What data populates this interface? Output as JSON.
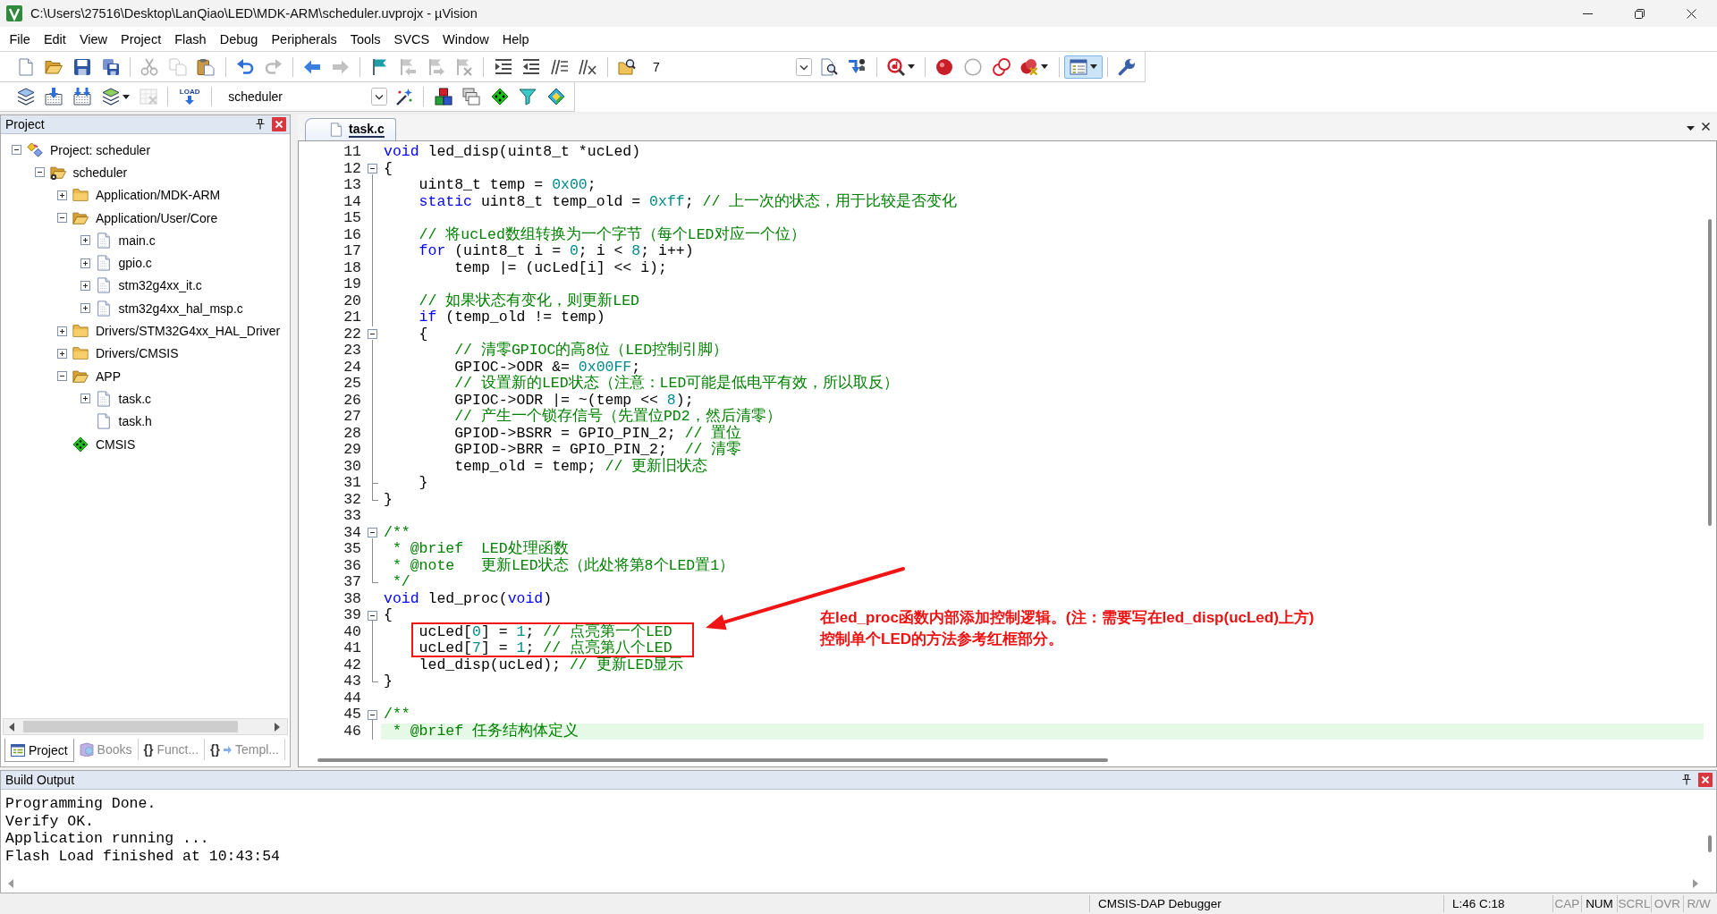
{
  "window": {
    "title": "C:\\Users\\27516\\Desktop\\LanQiao\\LED\\MDK-ARM\\scheduler.uvprojx - µVision"
  },
  "menu": [
    "File",
    "Edit",
    "View",
    "Project",
    "Flash",
    "Debug",
    "Peripherals",
    "Tools",
    "SVCS",
    "Window",
    "Help"
  ],
  "toolbars": [
    {
      "items": [
        {
          "kind": "new",
          "disabled": false,
          "pressed": false
        },
        {
          "kind": "open",
          "disabled": false,
          "pressed": false
        },
        {
          "kind": "save",
          "disabled": false,
          "pressed": false
        },
        {
          "kind": "saveall",
          "disabled": false,
          "pressed": false
        },
        {
          "kind": "separator"
        },
        {
          "kind": "cut",
          "disabled": true,
          "pressed": false
        },
        {
          "kind": "copy",
          "disabled": true,
          "pressed": false
        },
        {
          "kind": "paste",
          "disabled": false,
          "pressed": false
        },
        {
          "kind": "separator"
        },
        {
          "kind": "undo",
          "disabled": false,
          "pressed": false
        },
        {
          "kind": "redo",
          "disabled": true,
          "pressed": false
        },
        {
          "kind": "separator"
        },
        {
          "kind": "back",
          "disabled": false,
          "pressed": false
        },
        {
          "kind": "forward",
          "disabled": true,
          "pressed": false
        },
        {
          "kind": "separator"
        },
        {
          "kind": "bookmark",
          "disabled": false,
          "pressed": false
        },
        {
          "kind": "prevmark",
          "disabled": true,
          "pressed": false
        },
        {
          "kind": "nextmark",
          "disabled": true,
          "pressed": false
        },
        {
          "kind": "clearmarks",
          "disabled": true,
          "pressed": false
        },
        {
          "kind": "separator"
        },
        {
          "kind": "indent",
          "disabled": false,
          "pressed": false
        },
        {
          "kind": "outdent",
          "disabled": false,
          "pressed": false
        },
        {
          "kind": "comment",
          "disabled": false,
          "pressed": false
        },
        {
          "kind": "uncomment",
          "disabled": false,
          "pressed": false
        },
        {
          "kind": "separator"
        },
        {
          "kind": "findfiles",
          "disabled": false,
          "pressed": false
        },
        {
          "kind": "findcombo",
          "value": "7"
        },
        {
          "kind": "find",
          "disabled": false,
          "pressed": false
        },
        {
          "kind": "jump",
          "disabled": false,
          "pressed": false
        },
        {
          "kind": "separator"
        },
        {
          "kind": "magnifier",
          "disabled": false,
          "pressed": false
        },
        {
          "kind": "separator"
        },
        {
          "kind": "breakpoint",
          "disabled": false,
          "pressed": false
        },
        {
          "kind": "bpdisable",
          "disabled": false,
          "pressed": false
        },
        {
          "kind": "bpdisableall",
          "disabled": false,
          "pressed": false
        },
        {
          "kind": "bpkill",
          "disabled": false,
          "pressed": false
        },
        {
          "kind": "separator"
        },
        {
          "kind": "windows",
          "disabled": false,
          "pressed": true
        },
        {
          "kind": "separator"
        },
        {
          "kind": "config",
          "disabled": false,
          "pressed": false
        }
      ]
    },
    {
      "items": [
        {
          "kind": "translate",
          "disabled": false,
          "pressed": false
        },
        {
          "kind": "build",
          "disabled": false,
          "pressed": false
        },
        {
          "kind": "rebuild",
          "disabled": false,
          "pressed": false
        },
        {
          "kind": "batch",
          "disabled": false,
          "pressed": false
        },
        {
          "kind": "stop",
          "disabled": true,
          "pressed": false
        },
        {
          "kind": "separator"
        },
        {
          "kind": "load",
          "label": "LOAD",
          "disabled": false
        },
        {
          "kind": "separator"
        },
        {
          "kind": "targetcombo",
          "value": "scheduler"
        },
        {
          "kind": "wand",
          "disabled": false,
          "pressed": false
        },
        {
          "kind": "separator"
        },
        {
          "kind": "components",
          "disabled": false,
          "pressed": false
        },
        {
          "kind": "select",
          "disabled": false,
          "pressed": false
        },
        {
          "kind": "packs",
          "disabled": false,
          "pressed": false
        },
        {
          "kind": "funnel",
          "disabled": false,
          "pressed": false
        },
        {
          "kind": "tiles",
          "disabled": false,
          "pressed": false
        }
      ]
    }
  ],
  "project_panel": {
    "title": "Project",
    "tree": [
      {
        "label": "Project: scheduler",
        "kind": "project",
        "expanded": true,
        "children": [
          {
            "label": "scheduler",
            "kind": "target",
            "expanded": true,
            "children": [
              {
                "label": "Application/MDK-ARM",
                "kind": "group",
                "expanded": false
              },
              {
                "label": "Application/User/Core",
                "kind": "group",
                "expanded": true,
                "children": [
                  {
                    "label": "main.c",
                    "kind": "source",
                    "expanded": false
                  },
                  {
                    "label": "gpio.c",
                    "kind": "source",
                    "expanded": false
                  },
                  {
                    "label": "stm32g4xx_it.c",
                    "kind": "source",
                    "expanded": false
                  },
                  {
                    "label": "stm32g4xx_hal_msp.c",
                    "kind": "source",
                    "expanded": false
                  }
                ]
              },
              {
                "label": "Drivers/STM32G4xx_HAL_Driver",
                "kind": "group",
                "expanded": false
              },
              {
                "label": "Drivers/CMSIS",
                "kind": "group",
                "expanded": false
              },
              {
                "label": "APP",
                "kind": "group",
                "expanded": true,
                "children": [
                  {
                    "label": "task.c",
                    "kind": "source",
                    "expanded": false
                  },
                  {
                    "label": "task.h",
                    "kind": "header"
                  }
                ]
              },
              {
                "label": "CMSIS",
                "kind": "component"
              }
            ]
          }
        ]
      }
    ],
    "tabs": [
      {
        "label": "Project",
        "kind": "project",
        "selected": true
      },
      {
        "label": "Books",
        "kind": "books",
        "selected": false
      },
      {
        "label": "Funct...",
        "kind": "functions",
        "glyph": "{}",
        "selected": false
      },
      {
        "label": "Templ...",
        "kind": "templates",
        "glyph": "{}",
        "selected": false
      }
    ]
  },
  "editor": {
    "tabs": [
      {
        "label": "task.c",
        "selected": true
      }
    ],
    "lines": [
      {
        "n": "11",
        "kind": "plain",
        "current": false,
        "parts": [
          {
            "kind": "keyword",
            "text": "void"
          },
          {
            "kind": "plain",
            "text": " led_disp(uint8_t *ucLed)"
          }
        ]
      },
      {
        "n": "12",
        "kind": "foldstart",
        "current": false,
        "parts": [
          {
            "kind": "plain",
            "text": "{"
          }
        ]
      },
      {
        "n": "13",
        "kind": "foldline",
        "current": false,
        "parts": [
          {
            "kind": "plain",
            "text": "    uint8_t temp = "
          },
          {
            "kind": "number",
            "text": "0x00"
          },
          {
            "kind": "plain",
            "text": ";"
          }
        ]
      },
      {
        "n": "14",
        "kind": "foldline",
        "current": false,
        "parts": [
          {
            "kind": "keyword",
            "text": "    static"
          },
          {
            "kind": "plain",
            "text": " uint8_t temp_old = "
          },
          {
            "kind": "number",
            "text": "0xff"
          },
          {
            "kind": "plain",
            "text": "; "
          },
          {
            "kind": "comment",
            "text": "// 上一次的状态，用于比较是否变化"
          }
        ]
      },
      {
        "n": "15",
        "kind": "foldline",
        "current": false
      },
      {
        "n": "16",
        "kind": "foldline",
        "current": false,
        "parts": [
          {
            "kind": "comment",
            "text": "    // 将ucLed数组转换为一个字节（每个LED对应一个位）"
          }
        ]
      },
      {
        "n": "17",
        "kind": "foldline",
        "current": false,
        "parts": [
          {
            "kind": "keyword",
            "text": "    for"
          },
          {
            "kind": "plain",
            "text": " (uint8_t i = "
          },
          {
            "kind": "number",
            "text": "0"
          },
          {
            "kind": "plain",
            "text": "; i < "
          },
          {
            "kind": "number",
            "text": "8"
          },
          {
            "kind": "plain",
            "text": "; i++)"
          }
        ]
      },
      {
        "n": "18",
        "kind": "foldline",
        "current": false,
        "parts": [
          {
            "kind": "plain",
            "text": "        temp |= (ucLed[i] << i);"
          }
        ]
      },
      {
        "n": "19",
        "kind": "foldline",
        "current": false
      },
      {
        "n": "20",
        "kind": "foldline",
        "current": false,
        "parts": [
          {
            "kind": "comment",
            "text": "    // 如果状态有变化，则更新LED"
          }
        ]
      },
      {
        "n": "21",
        "kind": "foldline",
        "current": false,
        "parts": [
          {
            "kind": "keyword",
            "text": "    if"
          },
          {
            "kind": "plain",
            "text": " (temp_old != temp)"
          }
        ]
      },
      {
        "n": "22",
        "kind": "foldstart",
        "current": false,
        "parts": [
          {
            "kind": "plain",
            "text": "    {"
          }
        ]
      },
      {
        "n": "23",
        "kind": "foldline",
        "current": false,
        "parts": [
          {
            "kind": "comment",
            "text": "        // 清零GPIOC的高8位（LED控制引脚）"
          }
        ]
      },
      {
        "n": "24",
        "kind": "foldline",
        "current": false,
        "parts": [
          {
            "kind": "plain",
            "text": "        GPIOC->ODR &= "
          },
          {
            "kind": "number",
            "text": "0x00FF"
          },
          {
            "kind": "plain",
            "text": ";"
          }
        ]
      },
      {
        "n": "25",
        "kind": "foldline",
        "current": false,
        "parts": [
          {
            "kind": "comment",
            "text": "        // 设置新的LED状态（注意：LED可能是低电平有效，所以取反）"
          }
        ]
      },
      {
        "n": "26",
        "kind": "foldline",
        "current": false,
        "parts": [
          {
            "kind": "plain",
            "text": "        GPIOC->ODR |= ~(temp << "
          },
          {
            "kind": "number",
            "text": "8"
          },
          {
            "kind": "plain",
            "text": ");"
          }
        ]
      },
      {
        "n": "27",
        "kind": "foldline",
        "current": false,
        "parts": [
          {
            "kind": "comment",
            "text": "        // 产生一个锁存信号（先置位PD2，然后清零）"
          }
        ]
      },
      {
        "n": "28",
        "kind": "foldline",
        "current": false,
        "parts": [
          {
            "kind": "plain",
            "text": "        GPIOD->BSRR = GPIO_PIN_2; "
          },
          {
            "kind": "comment",
            "text": "// 置位"
          }
        ]
      },
      {
        "n": "29",
        "kind": "foldline",
        "current": false,
        "parts": [
          {
            "kind": "plain",
            "text": "        GPIOD->BRR = GPIO_PIN_2;  "
          },
          {
            "kind": "comment",
            "text": "// 清零"
          }
        ]
      },
      {
        "n": "30",
        "kind": "foldline",
        "current": false,
        "parts": [
          {
            "kind": "plain",
            "text": "        temp_old = temp; "
          },
          {
            "kind": "comment",
            "text": "// 更新旧状态"
          }
        ]
      },
      {
        "n": "31",
        "kind": "foldbranch",
        "current": false,
        "parts": [
          {
            "kind": "plain",
            "text": "    }"
          }
        ]
      },
      {
        "n": "32",
        "kind": "foldend",
        "current": false,
        "parts": [
          {
            "kind": "plain",
            "text": "}"
          }
        ]
      },
      {
        "n": "33",
        "kind": "plain",
        "current": false
      },
      {
        "n": "34",
        "kind": "foldstart",
        "current": false,
        "parts": [
          {
            "kind": "comment",
            "text": "/**"
          }
        ]
      },
      {
        "n": "35",
        "kind": "foldline",
        "current": false,
        "parts": [
          {
            "kind": "comment",
            "text": " * @brief  LED处理函数"
          }
        ]
      },
      {
        "n": "36",
        "kind": "foldline",
        "current": false,
        "parts": [
          {
            "kind": "comment",
            "text": " * @note   更新LED状态（此处将第8个LED置1）"
          }
        ]
      },
      {
        "n": "37",
        "kind": "foldend",
        "current": false,
        "parts": [
          {
            "kind": "comment",
            "text": " */"
          }
        ]
      },
      {
        "n": "38",
        "kind": "plain",
        "current": false,
        "parts": [
          {
            "kind": "keyword",
            "text": "void"
          },
          {
            "kind": "plain",
            "text": " led_proc("
          },
          {
            "kind": "keyword",
            "text": "void"
          },
          {
            "kind": "plain",
            "text": ")"
          }
        ]
      },
      {
        "n": "39",
        "kind": "foldstart",
        "current": false,
        "parts": [
          {
            "kind": "plain",
            "text": "{"
          }
        ]
      },
      {
        "n": "40",
        "kind": "foldline",
        "current": false,
        "parts": [
          {
            "kind": "plain",
            "text": "    ucLed["
          },
          {
            "kind": "number",
            "text": "0"
          },
          {
            "kind": "plain",
            "text": "] = "
          },
          {
            "kind": "number",
            "text": "1"
          },
          {
            "kind": "plain",
            "text": "; "
          },
          {
            "kind": "comment",
            "text": "// 点亮第一个LED"
          }
        ]
      },
      {
        "n": "41",
        "kind": "foldline",
        "current": false,
        "parts": [
          {
            "kind": "plain",
            "text": "    ucLed["
          },
          {
            "kind": "number",
            "text": "7"
          },
          {
            "kind": "plain",
            "text": "] = "
          },
          {
            "kind": "number",
            "text": "1"
          },
          {
            "kind": "plain",
            "text": "; "
          },
          {
            "kind": "comment",
            "text": "// 点亮第八个LED"
          }
        ]
      },
      {
        "n": "42",
        "kind": "foldline",
        "current": false,
        "parts": [
          {
            "kind": "plain",
            "text": "    led_disp(ucLed); "
          },
          {
            "kind": "comment",
            "text": "// 更新LED显示"
          }
        ]
      },
      {
        "n": "43",
        "kind": "foldend",
        "current": false,
        "parts": [
          {
            "kind": "plain",
            "text": "}"
          }
        ]
      },
      {
        "n": "44",
        "kind": "plain",
        "current": false
      },
      {
        "n": "45",
        "kind": "foldstart",
        "current": false,
        "parts": [
          {
            "kind": "comment",
            "text": "/**"
          }
        ]
      },
      {
        "n": "46",
        "kind": "foldline",
        "current": true,
        "parts": [
          {
            "kind": "comment",
            "text": " * @brief 任务结构体定义"
          }
        ]
      }
    ],
    "annotation": {
      "lines": [
        "在led_proc函数内部添加控制逻辑。(注：需要写在led_disp(ucLed)上方)",
        "控制单个LED的方法参考红框部分。"
      ]
    }
  },
  "build_output": {
    "title": "Build Output",
    "lines": [
      "Programming Done.",
      "Verify OK.",
      "Application running ...",
      "Flash Load finished at 10:43:54"
    ]
  },
  "status_bar": {
    "debugger": "CMSIS-DAP Debugger",
    "position": "L:46 C:18",
    "indicators": [
      {
        "label": "CAP",
        "on": false
      },
      {
        "label": "NUM",
        "on": true
      },
      {
        "label": "SCRL",
        "on": false
      },
      {
        "label": "OVR",
        "on": false
      },
      {
        "label": "R/W",
        "on": false
      }
    ]
  }
}
